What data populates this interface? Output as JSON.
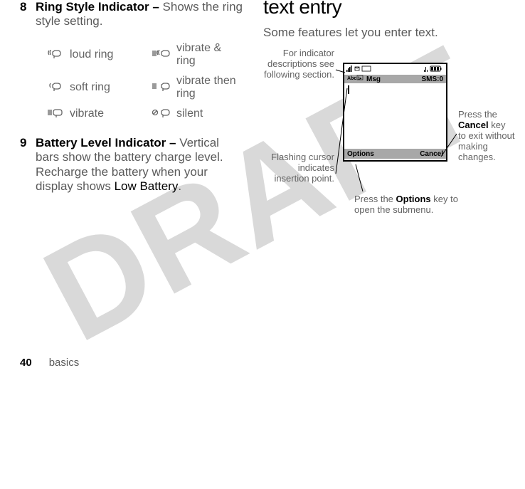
{
  "draft_watermark": "DRAFT",
  "left": {
    "item8": {
      "num": "8",
      "title": "Ring Style Indicator – ",
      "desc": "Shows the ring style setting."
    },
    "ring_styles": {
      "r1c1": "loud ring",
      "r1c2": "vibrate & ring",
      "r2c1": "soft ring",
      "r2c2": "vibrate then ring",
      "r3c1": "vibrate",
      "r3c2": "silent"
    },
    "item9": {
      "num": "9",
      "title": "Battery Level Indicator – ",
      "desc": "Vertical bars show the battery charge level. Recharge the battery when your display shows ",
      "low": "Low Battery",
      "period": "."
    }
  },
  "right": {
    "heading": "text entry",
    "sub": "Some features let you enter text.",
    "callouts": {
      "tl": "For indicator descriptions see following section.",
      "bl": "Flashing cursor indicates insertion point.",
      "bc_pre": "Press the ",
      "bc_bold": "Options",
      "bc_post": " key to open the submenu.",
      "r_pre": "Press the ",
      "r_bold": "Cancel",
      "r_post": " key to exit without making changes."
    },
    "phone": {
      "title_left": "Msg",
      "title_right": "SMS:0",
      "soft_left": "Options",
      "soft_right": "Cancel"
    }
  },
  "footer": {
    "page": "40",
    "section": "basics"
  }
}
